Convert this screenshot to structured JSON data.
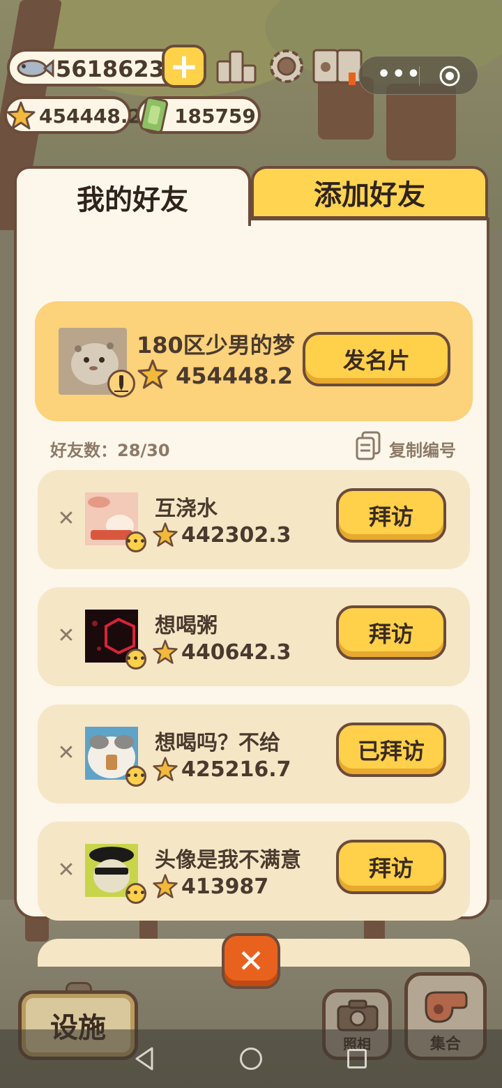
{
  "hud": {
    "fish_count": "56186237",
    "star_count": "454448.2",
    "cash_count": "185759",
    "icons": [
      "fish-icon",
      "plus-icon",
      "ranking-icon",
      "gear-icon",
      "paw-book-icon",
      "star-icon",
      "cash-icon",
      "more-dots-icon",
      "target-icon"
    ]
  },
  "tabs": {
    "my_friends": "我的好友",
    "add_friends": "添加好友"
  },
  "me": {
    "name": "180区少男的梦",
    "score": "454448.2",
    "card_button": "发名片"
  },
  "friends_meta": {
    "count_label": "好友数：28/30",
    "copy_label": "复制编号"
  },
  "friends": [
    {
      "name": "互浇水",
      "score": "442302.3",
      "button": "拜访",
      "visited": false
    },
    {
      "name": "想喝粥",
      "score": "440642.3",
      "button": "拜访",
      "visited": false
    },
    {
      "name": "想喝吗？不给",
      "score": "425216.7",
      "button": "已拜访",
      "visited": true
    },
    {
      "name": "头像是我不满意",
      "score": "413987",
      "button": "拜访",
      "visited": false
    }
  ],
  "bottom": {
    "facility": "设施",
    "photo": "照相",
    "gather": "集合"
  },
  "colors": {
    "panel_bg": "#fdf6ea",
    "border": "#6b4c3b",
    "button_yellow": "#ffd04a",
    "card_yellow": "#fcd27a",
    "row_bg": "#f5e6c6",
    "close_orange": "#e8621e"
  }
}
